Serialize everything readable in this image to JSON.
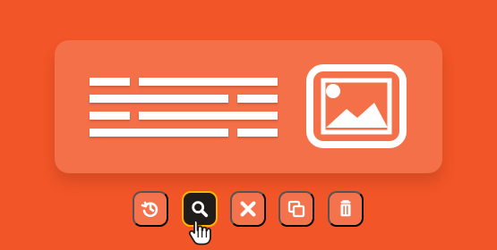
{
  "colors": {
    "background": "#f25527",
    "card": "rgba(255,255,255,0.16)",
    "active_button": "#1f1c1a",
    "active_border": "#ffb400"
  },
  "card": {
    "text_block_icon": "lines-icon",
    "image_icon": "image-placeholder-icon"
  },
  "actions": [
    {
      "name": "replace",
      "icon": "history-icon"
    },
    {
      "name": "search",
      "icon": "search-icon",
      "active": true
    },
    {
      "name": "close",
      "icon": "close-icon"
    },
    {
      "name": "duplicate",
      "icon": "copy-icon"
    },
    {
      "name": "delete",
      "icon": "trash-icon"
    }
  ]
}
